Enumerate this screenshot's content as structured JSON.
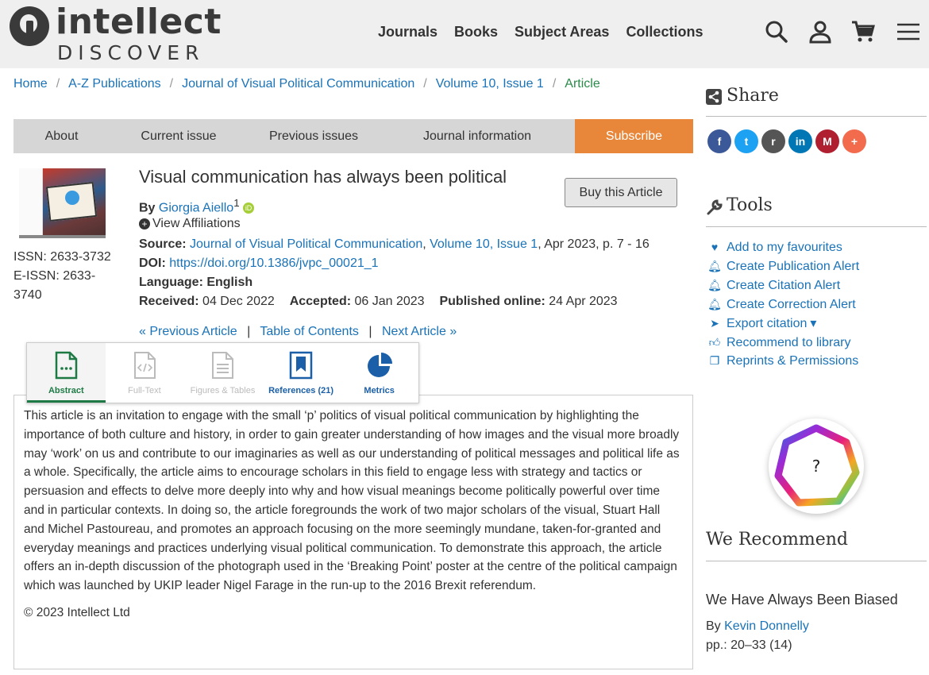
{
  "header": {
    "logo_word": "intellect",
    "logo_sub": "DISCOVER",
    "nav": [
      "Journals",
      "Books",
      "Subject Areas",
      "Collections"
    ],
    "icons": [
      "search-icon",
      "user-icon",
      "cart-icon",
      "menu-icon"
    ]
  },
  "breadcrumb": {
    "items": [
      "Home",
      "A-Z Publications",
      "Journal of Visual Political Communication",
      "Volume 10, Issue 1"
    ],
    "current": "Article",
    "separator": "/"
  },
  "journal_tabs": {
    "items": [
      "About",
      "Current issue",
      "Previous issues",
      "Journal information"
    ],
    "subscribe": "Subscribe"
  },
  "cover": {
    "issn": "ISSN: 2633-3732",
    "eissn_line1": "E-ISSN: 2633-",
    "eissn_line2": "3740"
  },
  "article": {
    "title": "Visual communication has always been political",
    "buy_label": "Buy this Article",
    "by_label": "By",
    "author": "Giorgia Aiello",
    "author_sup": "1",
    "orcid_glyph": "iD",
    "view_affiliations": "View Affiliations",
    "source_label": "Source:",
    "source_journal": "Journal of Visual Political Communication",
    "source_issue": "Volume 10, Issue 1",
    "source_rest": ", Apr 2023, p. 7 - 16",
    "doi_label": "DOI:",
    "doi": "https://doi.org/10.1386/jvpc_00021_1",
    "language": "Language: English",
    "received_label": "Received:",
    "received": "04 Dec 2022",
    "accepted_label": "Accepted:",
    "accepted": "06 Jan 2023",
    "published_label": "Published online:",
    "published": "24 Apr 2023"
  },
  "article_nav": {
    "prev": "« Previous Article",
    "toc": "Table of Contents",
    "next": "Next Article »",
    "sep": "|"
  },
  "content_tabs": [
    {
      "label": "Abstract",
      "icon": "document-icon",
      "state": "active"
    },
    {
      "label": "Full-Text",
      "icon": "code-document-icon",
      "state": "disabled"
    },
    {
      "label": "Figures & Tables",
      "icon": "list-document-icon",
      "state": "disabled"
    },
    {
      "label": "References (21)",
      "icon": "bookmark-icon",
      "state": "enabled"
    },
    {
      "label": "Metrics",
      "icon": "pie-chart-icon",
      "state": "enabled"
    }
  ],
  "abstract": {
    "text": "This article is an invitation to engage with the small ‘p’ politics of visual political communication by highlighting the importance of both culture and history, in order to gain greater understanding of how images and the visual more broadly may ‘work’ on us and contribute to our imaginaries as well as our understanding of political messages and political life as a whole. Specifically, the article aims to encourage scholars in this field to engage less with strategy and tactics or persuasion and effects to delve more deeply into why and how visual meanings become politically powerful over time and in particular contexts. In doing so, the article foregrounds the work of two major scholars of the visual, Stuart Hall and Michel Pastoureau, and promotes an approach focusing on the more seemingly mundane, taken-for-granted and everyday meanings and practices underlying visual political communication. To demonstrate this approach, the article offers an in-depth discussion of the photograph used in the ‘Breaking Point’ poster at the centre of the political campaign which was launched by UKIP leader Nigel Farage in the run-up to the 2016 Brexit referendum.",
    "copyright": "© 2023 Intellect Ltd"
  },
  "sidebar": {
    "share_heading": "Share",
    "social": [
      {
        "name": "facebook",
        "glyph": "f",
        "color": "#3b5998"
      },
      {
        "name": "twitter",
        "glyph": "t",
        "color": "#1da1f2"
      },
      {
        "name": "reddit",
        "glyph": "r",
        "color": "#555555"
      },
      {
        "name": "linkedin",
        "glyph": "in",
        "color": "#0077b5"
      },
      {
        "name": "mendeley",
        "glyph": "M",
        "color": "#b01f2f"
      },
      {
        "name": "more",
        "glyph": "+",
        "color": "#f26b4d"
      }
    ],
    "tools_heading": "Tools",
    "tools": [
      {
        "label": "Add to my favourites",
        "icon": "heart-icon"
      },
      {
        "label": "Create Publication Alert",
        "icon": "bell-icon"
      },
      {
        "label": "Create Citation Alert",
        "icon": "bell-icon"
      },
      {
        "label": "Create Correction Alert",
        "icon": "bell-icon"
      },
      {
        "label": "Export citation",
        "icon": "send-icon",
        "dropdown": "▾"
      },
      {
        "label": "Recommend to library",
        "icon": "thumbs-up-icon"
      },
      {
        "label": "Reprints & Permissions",
        "icon": "copy-icon"
      }
    ],
    "altmetric_score": "?",
    "recommend_heading": "We Recommend",
    "rec_title": "We Have Always Been Biased",
    "rec_by_label": "By",
    "rec_author": "Kevin Donnelly",
    "rec_pages": "pp.: 20–33 (14)"
  }
}
